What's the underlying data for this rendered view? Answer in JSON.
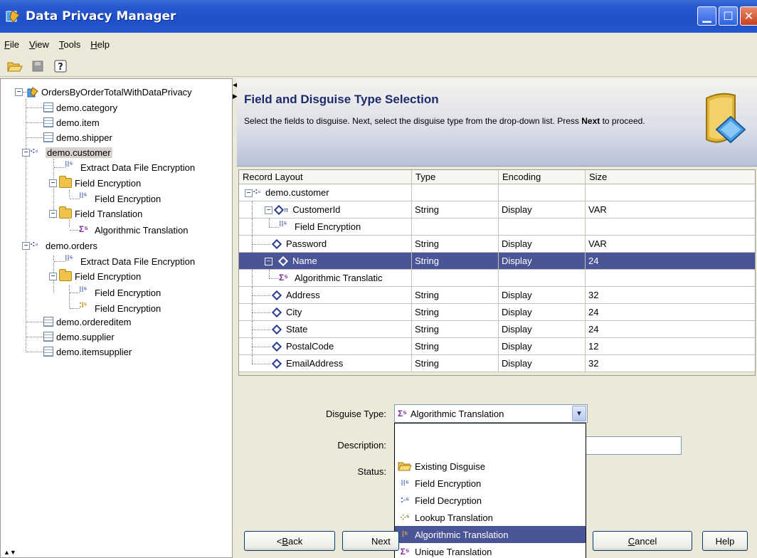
{
  "window": {
    "title": "Data Privacy Manager"
  },
  "menu": {
    "items": [
      {
        "label": "File",
        "ul": "F",
        "rest": "ile"
      },
      {
        "label": "View",
        "ul": "V",
        "rest": "iew"
      },
      {
        "label": "Tools",
        "ul": "T",
        "rest": "ools"
      },
      {
        "label": "Help",
        "ul": "H",
        "rest": "elp"
      }
    ]
  },
  "toolbar": {
    "icons": [
      "open-folder-icon",
      "save-icon",
      "help-icon"
    ]
  },
  "tree": {
    "root": "OrdersByOrderTotalWithDataPrivacy",
    "items": [
      "demo.category",
      "demo.item",
      "demo.shipper",
      "demo.customer",
      "Extract Data File Encryption",
      "Field Encryption",
      "Field Encryption",
      "Field Translation",
      "Algorithmic Translation",
      "demo.orders",
      "Extract Data File Encryption",
      "Field Encryption",
      "Field Encryption",
      "Field Encryption",
      "demo.ordereditem",
      "demo.supplier",
      "demo.itemsupplier"
    ]
  },
  "header": {
    "title": "Field and Disguise Type Selection",
    "desc_before": "Select the fields to disguise. Next, select the disguise type from the drop-down list. Press ",
    "desc_bold": "Next",
    "desc_after": " to proceed."
  },
  "grid": {
    "columns": [
      "Record Layout",
      "Type",
      "Encoding",
      "Size"
    ],
    "rows": [
      {
        "name": "demo.customer",
        "type": "",
        "encoding": "",
        "size": ""
      },
      {
        "name": "CustomerId",
        "type": "String",
        "encoding": "Display",
        "size": "VAR"
      },
      {
        "name": "Field Encryption",
        "type": "",
        "encoding": "",
        "size": ""
      },
      {
        "name": "Password",
        "type": "String",
        "encoding": "Display",
        "size": "VAR"
      },
      {
        "name": "Name",
        "type": "String",
        "encoding": "Display",
        "size": "24"
      },
      {
        "name": "Algorithmic Translatic",
        "type": "",
        "encoding": "",
        "size": ""
      },
      {
        "name": "Address",
        "type": "String",
        "encoding": "Display",
        "size": "32"
      },
      {
        "name": "City",
        "type": "String",
        "encoding": "Display",
        "size": "24"
      },
      {
        "name": "State",
        "type": "String",
        "encoding": "Display",
        "size": "24"
      },
      {
        "name": "PostalCode",
        "type": "String",
        "encoding": "Display",
        "size": "12"
      },
      {
        "name": "EmailAddress",
        "type": "String",
        "encoding": "Display",
        "size": "32"
      }
    ]
  },
  "form": {
    "disguise_type_label": "Disguise Type:",
    "disguise_type_value": "Algorithmic Translation",
    "description_label": "Description:",
    "status_label": "Status:",
    "options": [
      "Existing Disguise",
      "Field Encryption",
      "Field Decryption",
      "Lookup Translation",
      "Algorithmic Translation",
      "Unique Translation"
    ]
  },
  "buttons": {
    "back": "< Back",
    "back_ul": "B",
    "next": "Next",
    "cancel": "Cancel",
    "cancel_ul": "C",
    "help": "Help"
  },
  "colors": {
    "titlebar": "#2a5ad0",
    "selection": "#4a5597",
    "header_title": "#1d2a6b"
  }
}
